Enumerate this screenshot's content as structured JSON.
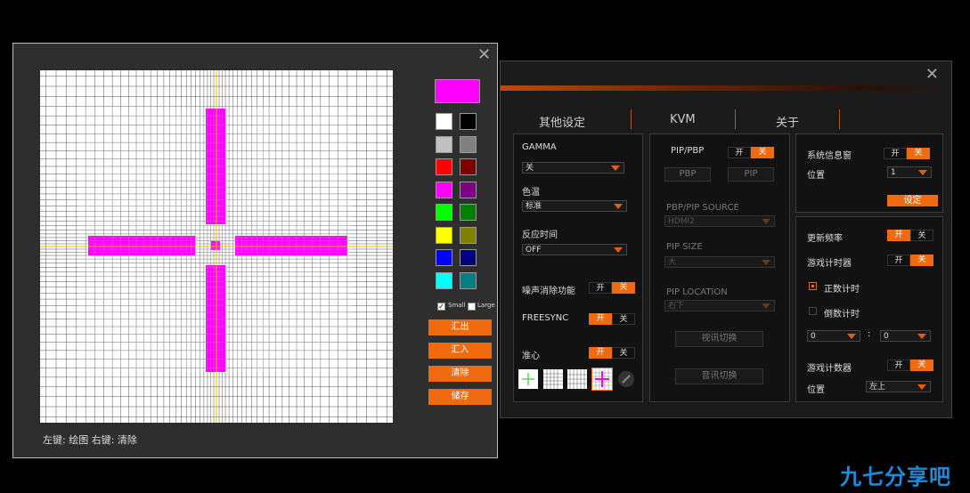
{
  "settings": {
    "close": "✕",
    "tabs": [
      "其他设定",
      "KVM",
      "关于"
    ],
    "col1": {
      "gamma_label": "GAMMA",
      "gamma_value": "关",
      "color_temp_label": "色温",
      "color_temp_value": "标准",
      "response_label": "反应时间",
      "response_value": "OFF",
      "noise_label": "噪声消除功能",
      "noise_on": "开",
      "noise_off": "关",
      "freesync_label": "FREESYNC",
      "freesync_on": "开",
      "freesync_off": "关",
      "crosshair_label": "准心",
      "crosshair_on": "开",
      "crosshair_off": "关"
    },
    "col2": {
      "pip_label": "PIP/PBP",
      "pip_on": "开",
      "pip_off": "关",
      "pbp_btn": "PBP",
      "pip_btn": "PIP",
      "source_label": "PBP/PIP SOURCE",
      "source_value": "HDMI2",
      "size_label": "PIP SIZE",
      "size_value": "大",
      "location_label": "PIP LOCATION",
      "location_value": "右下",
      "btn1": "视讯切换",
      "btn2": "音讯切换"
    },
    "col3": {
      "sysinfo_label": "系统信息窗",
      "sysinfo_on": "开",
      "sysinfo_off": "关",
      "position_label": "位置",
      "position_value": "1",
      "set_btn": "设定",
      "refresh_label": "更新频率",
      "refresh_on": "开",
      "refresh_off": "关",
      "timer_label": "游戏计时器",
      "timer_on": "开",
      "timer_off": "关",
      "countup_label": "正数计时",
      "countdown_label": "倒数计时",
      "min_value": "0",
      "sec_value": "0",
      "colon": ":",
      "counter_label": "游戏计数器",
      "counter_on": "开",
      "counter_off": "关",
      "counter_pos_label": "位置",
      "counter_pos_value": "左上"
    }
  },
  "editor": {
    "close": "✕",
    "footer": "左键: 绘图 右键: 清除",
    "current_color": "#ff00ff",
    "palette": [
      "#ffffff",
      "#000000",
      "#c0c0c0",
      "#808080",
      "#ff0000",
      "#800000",
      "#ff00ff",
      "#800080",
      "#00ff00",
      "#008000",
      "#ffff00",
      "#808000",
      "#0000ff",
      "#000080",
      "#00ffff",
      "#008080"
    ],
    "small_label": "Small",
    "large_label": "Large",
    "buttons": [
      "汇出",
      "汇入",
      "清除",
      "储存"
    ]
  },
  "watermark": "九七分享吧"
}
